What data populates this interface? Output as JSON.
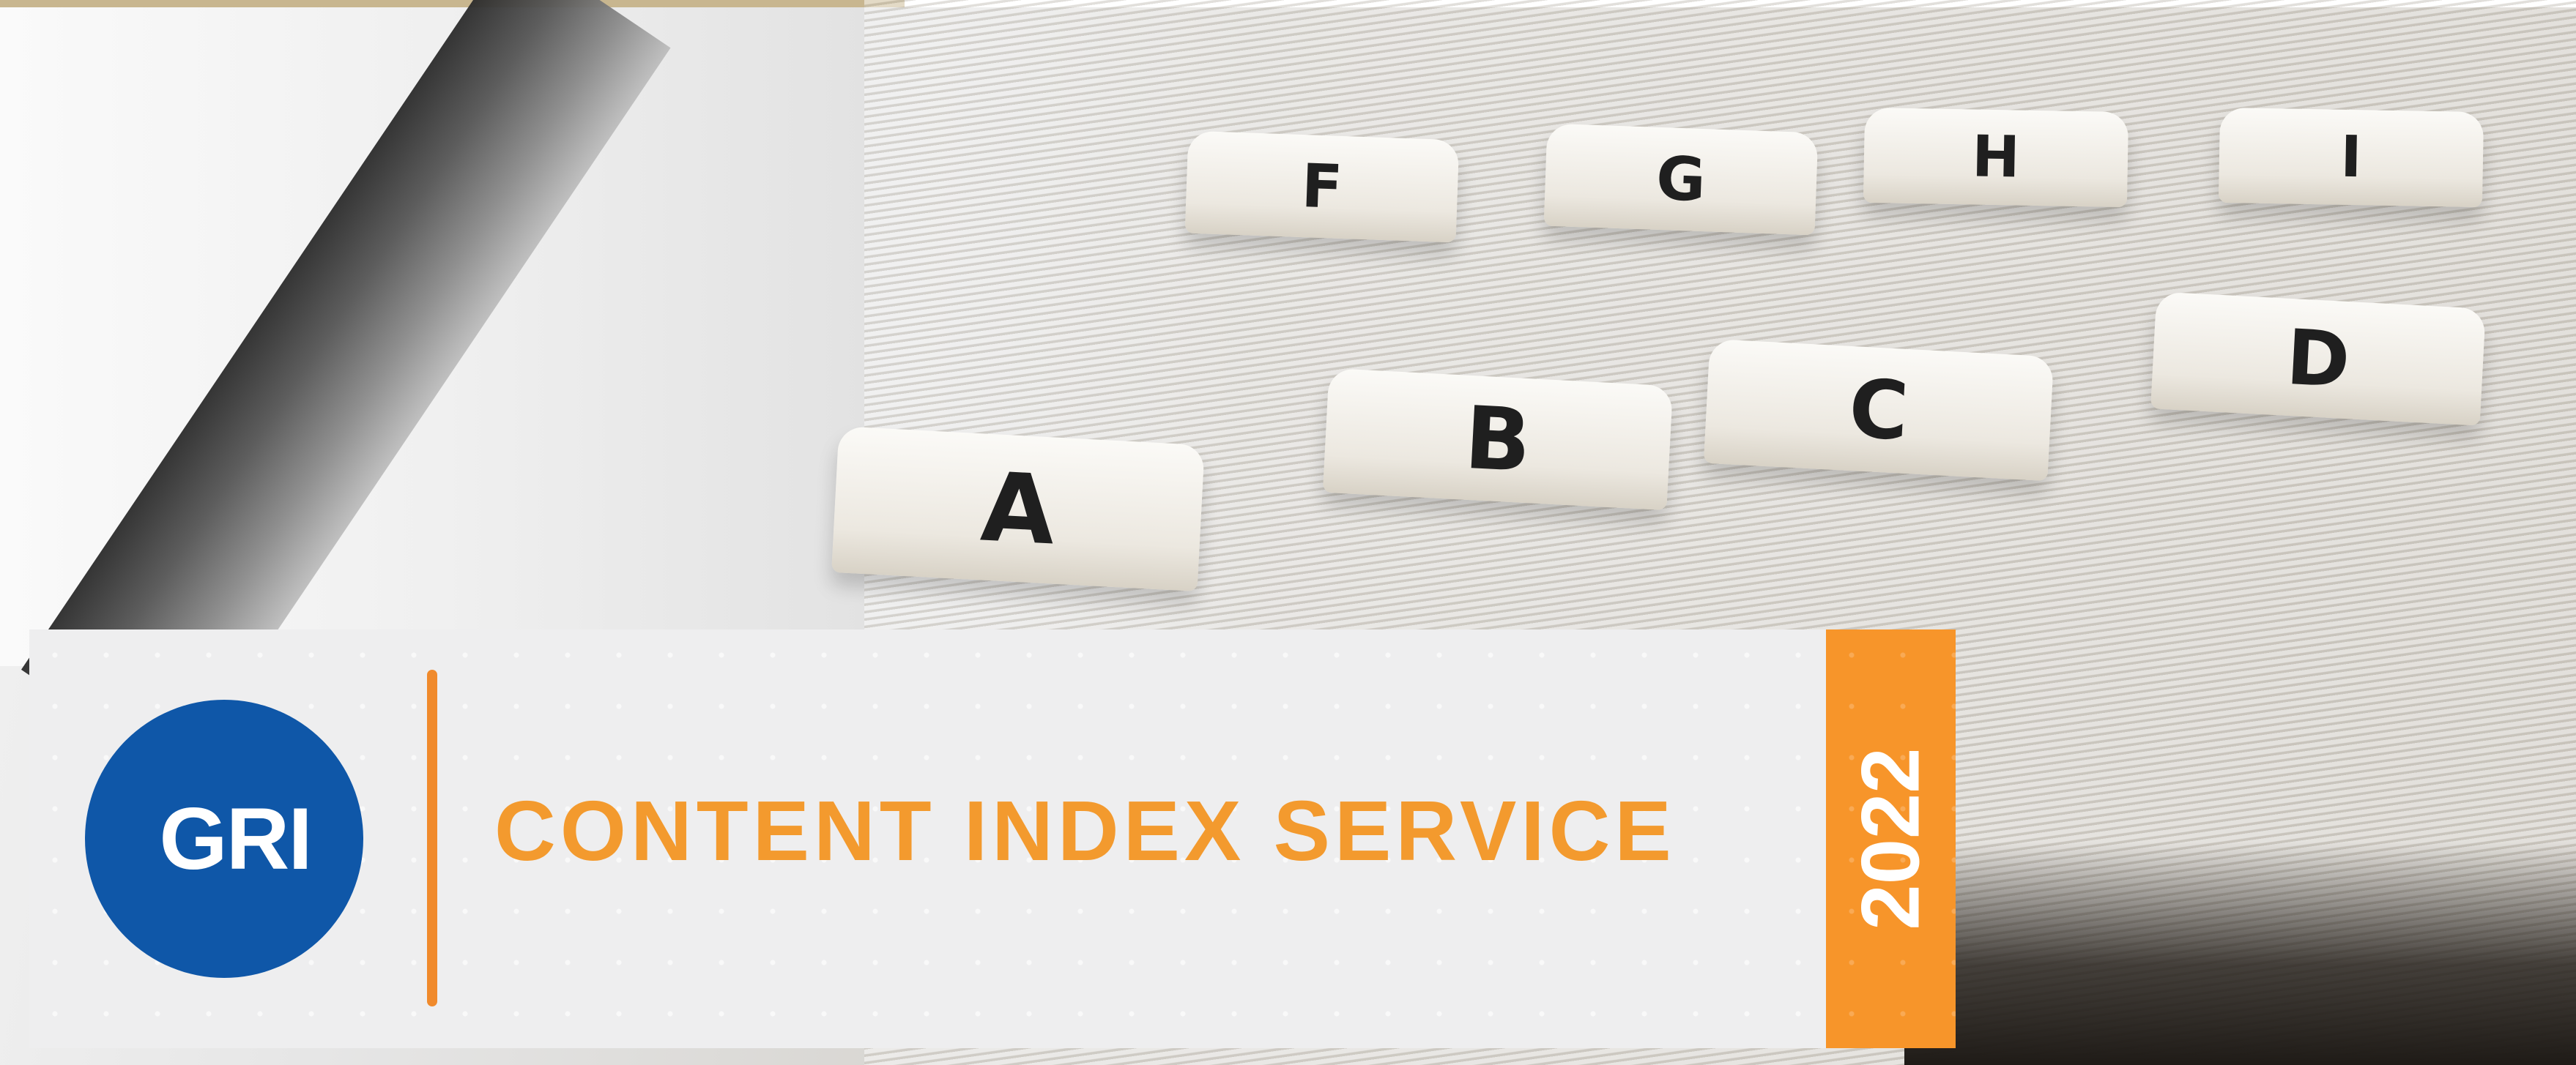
{
  "banner": {
    "logo_text": "GRI",
    "title": "CONTENT INDEX SERVICE",
    "year": "2022"
  },
  "tabs": [
    "F",
    "G",
    "H",
    "I",
    "A",
    "B",
    "C",
    "D"
  ],
  "colors": {
    "brand_blue": "#0f57a8",
    "accent_orange": "#f39a2e",
    "banner_bg": "#eeeeef",
    "top_accent": "#c8b68f"
  }
}
